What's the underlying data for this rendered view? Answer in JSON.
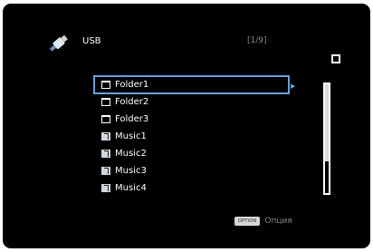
{
  "header": {
    "source_label": "USB",
    "page_indicator": "[1/9]",
    "usb_icon": "usb-stick-icon"
  },
  "list": {
    "selected_index": 0,
    "items": [
      {
        "label": "Folder1",
        "icon": "folder-icon"
      },
      {
        "label": "Folder2",
        "icon": "folder-icon"
      },
      {
        "label": "Folder3",
        "icon": "folder-icon"
      },
      {
        "label": "Music1",
        "icon": "music-file-icon"
      },
      {
        "label": "Music2",
        "icon": "music-file-icon"
      },
      {
        "label": "Music3",
        "icon": "music-file-icon"
      },
      {
        "label": "Music4",
        "icon": "music-file-icon"
      }
    ]
  },
  "footer": {
    "option_badge": "OPTION",
    "option_label": "Опция"
  },
  "colors": {
    "background": "#000000",
    "text": "#ffffff",
    "highlight": "#6e9fd9",
    "secondary_text": "#8a8a8a"
  }
}
